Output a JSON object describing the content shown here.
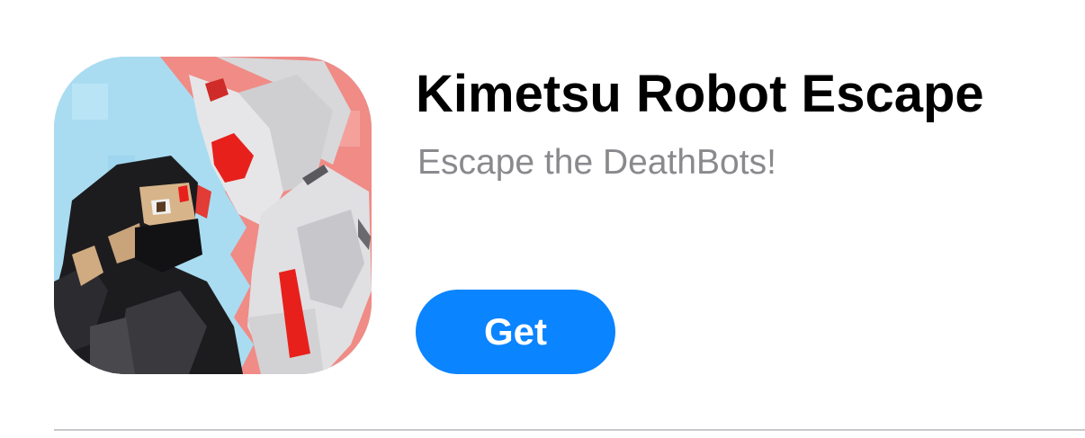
{
  "app": {
    "title": "Kimetsu Robot Escape",
    "subtitle": "Escape the DeathBots!",
    "icon": "kimetsu-robot-escape-app-icon"
  },
  "actions": {
    "get_label": "Get"
  },
  "colors": {
    "button_background": "#0a84ff",
    "title_text": "#000000",
    "subtitle_text": "#8a8a8e",
    "divider": "#c8c8cc"
  }
}
